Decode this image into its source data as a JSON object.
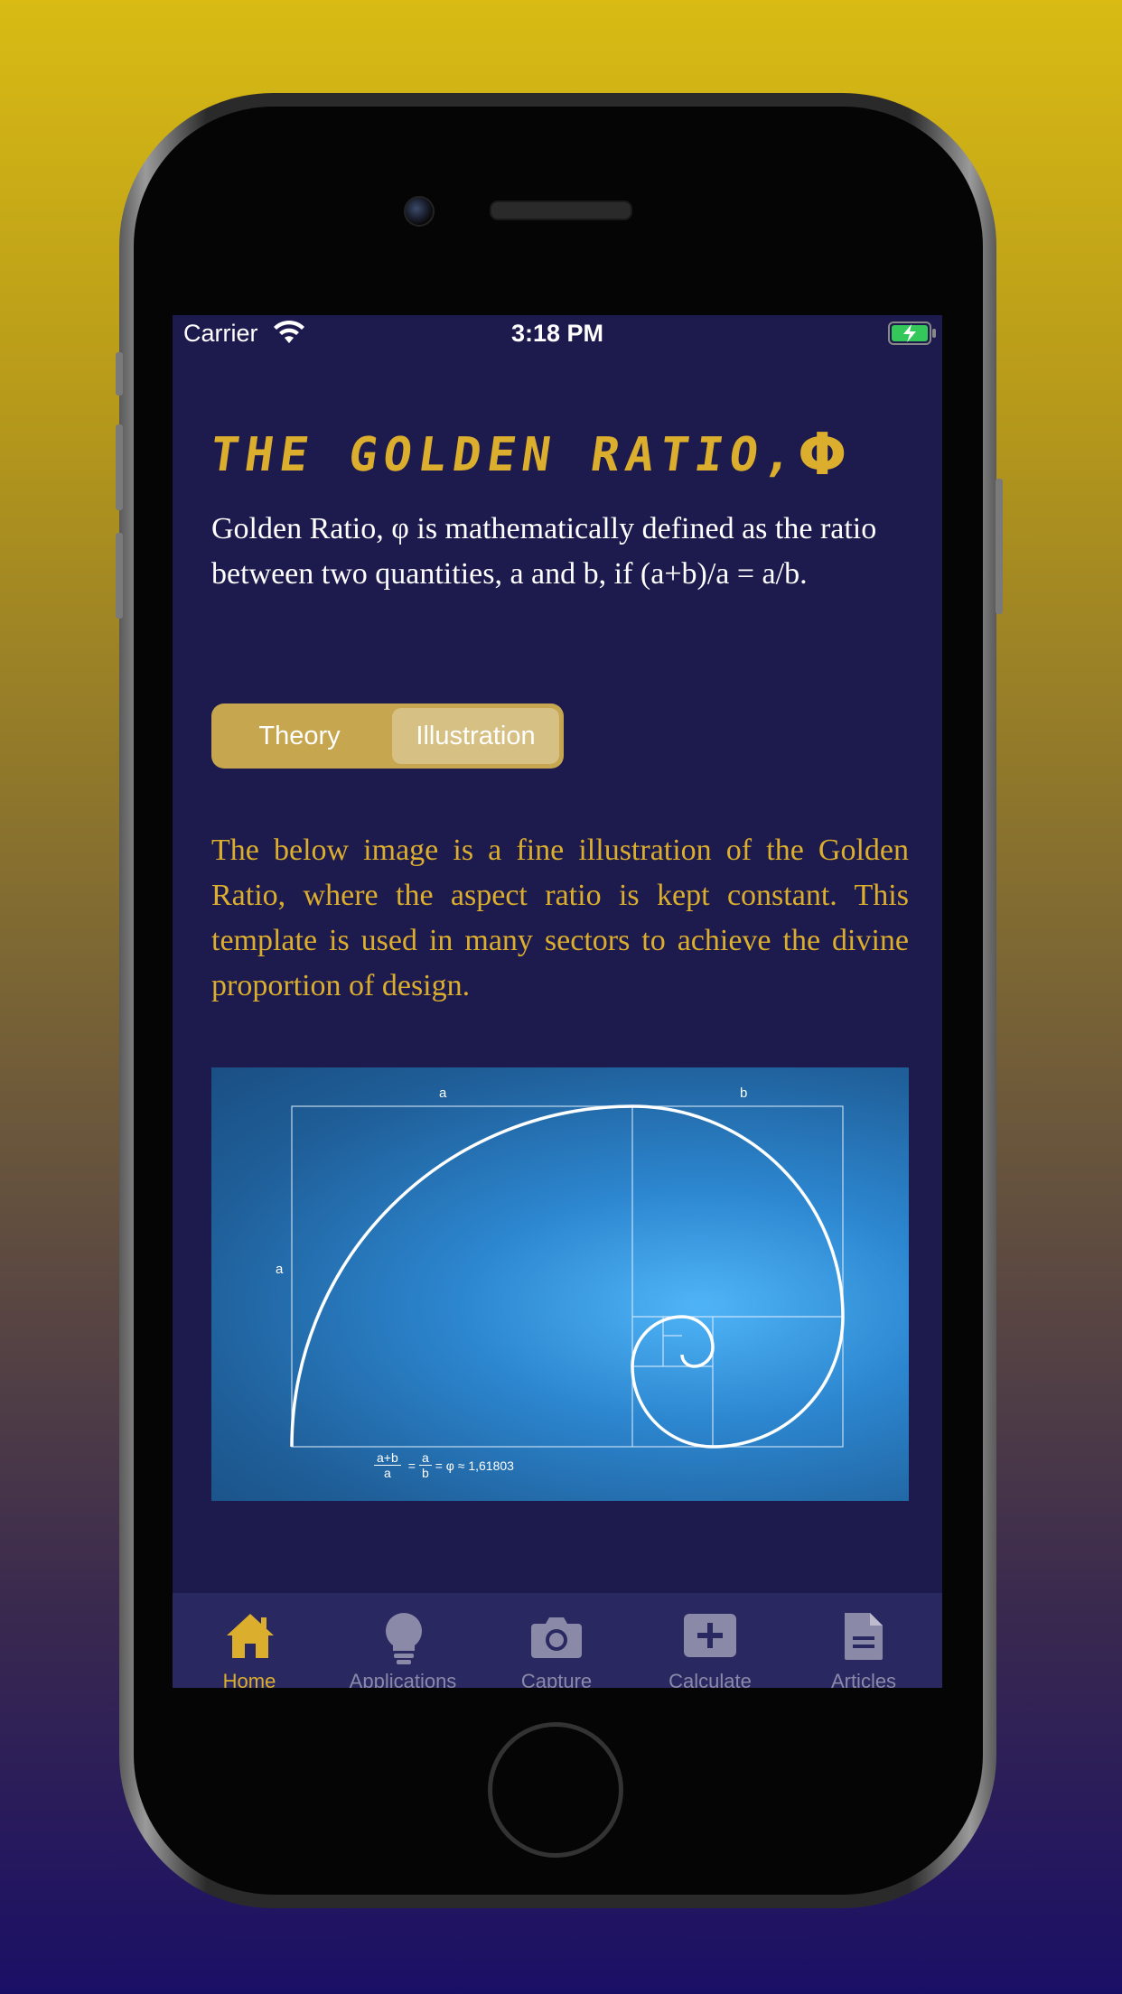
{
  "status_bar": {
    "carrier": "Carrier",
    "time": "3:18 PM"
  },
  "header": {
    "title": "THE GOLDEN RATIO,",
    "symbol": "Φ"
  },
  "intro": "Golden Ratio,  φ is mathematically defined as the ratio between two quantities, a and b, if (a+b)/a = a/b.",
  "segmented_control": {
    "options": [
      "Theory",
      "Illustration"
    ],
    "selected": "Illustration"
  },
  "description": "The below image is a fine illustration of the Golden Ratio, where the aspect ratio is kept constant. This template is used in many sectors to achieve the divine proportion of design.",
  "figure": {
    "label_top_a": "a",
    "label_top_b": "b",
    "label_side_a": "a",
    "formula_num1": "a+b",
    "formula_den1": "a",
    "formula_num2": "a",
    "formula_den2": "b",
    "formula_tail": "= φ ≈ 1,61803",
    "equals": "="
  },
  "tab_bar": {
    "items": [
      {
        "label": "Home",
        "icon": "home-icon",
        "active": true
      },
      {
        "label": "Applications",
        "icon": "lightbulb-icon",
        "active": false
      },
      {
        "label": "Capture",
        "icon": "camera-icon",
        "active": false
      },
      {
        "label": "Calculate",
        "icon": "plus-square-icon",
        "active": false
      },
      {
        "label": "Articles",
        "icon": "document-icon",
        "active": false
      }
    ]
  },
  "colors": {
    "background_top": "#d9bb14",
    "background_bottom": "#1a0f66",
    "screen": "#1d1a4d",
    "accent": "#dcae2e",
    "tab_bar": "#2a2860",
    "tab_inactive": "#8a89a8"
  }
}
